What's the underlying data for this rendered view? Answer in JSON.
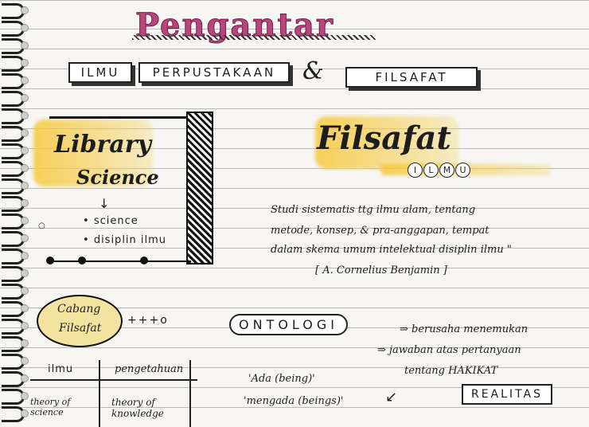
{
  "title": "Pengantar",
  "subtitle_boxes": [
    "ILMU",
    "PERPUSTAKAAN",
    "FILSAFAT"
  ],
  "ampersand": "&",
  "library": {
    "heading_line1": "Library",
    "heading_line2": "Science",
    "arrow": "↓",
    "items": [
      "science",
      "disiplin ilmu"
    ]
  },
  "filsafat": {
    "heading": "Filsafat",
    "ilmu_letters": [
      "I",
      "L",
      "M",
      "U"
    ],
    "definition_lines": [
      "Studi sistematis ttg ilmu alam, tentang",
      "metode, konsep, & pra-anggapan, tempat",
      "dalam skema umum intelektual disiplin ilmu \""
    ],
    "citation": "[ A. Cornelius Benjamin ]"
  },
  "cabang": {
    "label_line1": "Cabang",
    "label_line2": "Filsafat"
  },
  "ontologi": {
    "label": "ONTOLOGI",
    "desc_line1": "berusaha menemukan",
    "desc_line2": "jawaban atas pertanyaan",
    "desc_line3": "tentang HAKIKAT",
    "realitas": "REALITAS",
    "quote1": "'Ada (being)'",
    "quote2": "'mengada (beings)'"
  },
  "table": {
    "headers": [
      "ilmu",
      "pengetahuan"
    ],
    "row1": [
      "theory of science",
      "theory of knowledge"
    ]
  }
}
